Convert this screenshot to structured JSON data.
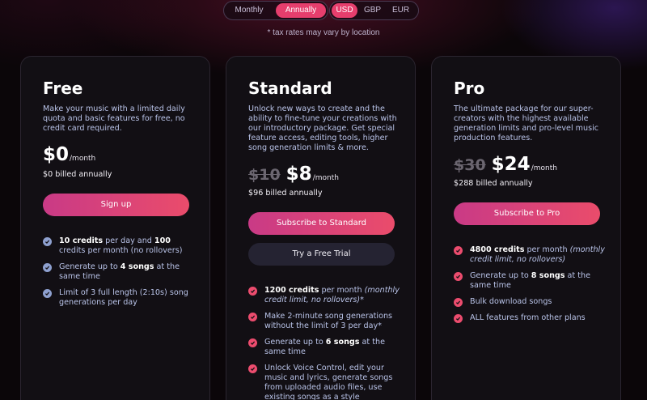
{
  "billing_toggle": {
    "options": [
      "Monthly",
      "Annually"
    ],
    "selected": "Annually"
  },
  "currency_toggle": {
    "options": [
      "USD",
      "GBP",
      "EUR"
    ],
    "selected": "USD"
  },
  "tax_note": "* tax rates may vary by location",
  "colors": {
    "accent": "#e63e6d",
    "free_check": "#8ea0cf",
    "paid_check": "#ec4c6e"
  },
  "plans": [
    {
      "name": "Free",
      "description": "Make your music with a limited daily quota and basic features for free, no credit card required.",
      "old_price": "",
      "price": "$0",
      "per": "/month",
      "billed": "$0 billed annually",
      "primary_button": "Sign up",
      "features": [
        {
          "bold": "10 credits",
          "text": " per day and ",
          "bold2": "100",
          "text2": " credits per month (no rollovers)"
        },
        {
          "text": "Generate up to ",
          "bold": "4 songs",
          "text2": " at the same time"
        },
        {
          "text": "Limit of 3 full length (2:10s) song generations per day"
        }
      ]
    },
    {
      "name": "Standard",
      "description": "Unlock new ways to create and the ability to fine-tune your creations with our introductory package. Get special feature access, editing tools, higher song generation limits & more.",
      "old_price": "$10",
      "price": "$8",
      "per": "/month",
      "billed": "$96 billed annually",
      "primary_button": "Subscribe to Standard",
      "secondary_button": "Try a Free Trial",
      "features": [
        {
          "bold": "1200 credits",
          "text": " per month ",
          "italic": "(monthly credit limit, no rollovers)",
          "text2": "*"
        },
        {
          "text": "Make 2-minute song generations without the limit of 3 per day*"
        },
        {
          "text": "Generate up to ",
          "bold": "6 songs",
          "text2": " at the same time"
        },
        {
          "text": "Unlock Voice Control, edit your music and lyrics, generate songs from uploaded audio files, use existing songs as a style"
        }
      ]
    },
    {
      "name": "Pro",
      "description": "The ultimate package for our super-creators with the highest available generation limits and pro-level music production features.",
      "old_price": "$30",
      "price": "$24",
      "per": "/month",
      "billed": "$288 billed annually",
      "primary_button": "Subscribe to Pro",
      "features": [
        {
          "bold": "4800 credits",
          "text": " per month ",
          "italic": "(monthly credit limit, no rollovers)"
        },
        {
          "text": "Generate up to ",
          "bold": "8 songs",
          "text2": " at the same time"
        },
        {
          "text": "Bulk download songs"
        },
        {
          "text": "ALL features from other plans"
        }
      ]
    }
  ]
}
